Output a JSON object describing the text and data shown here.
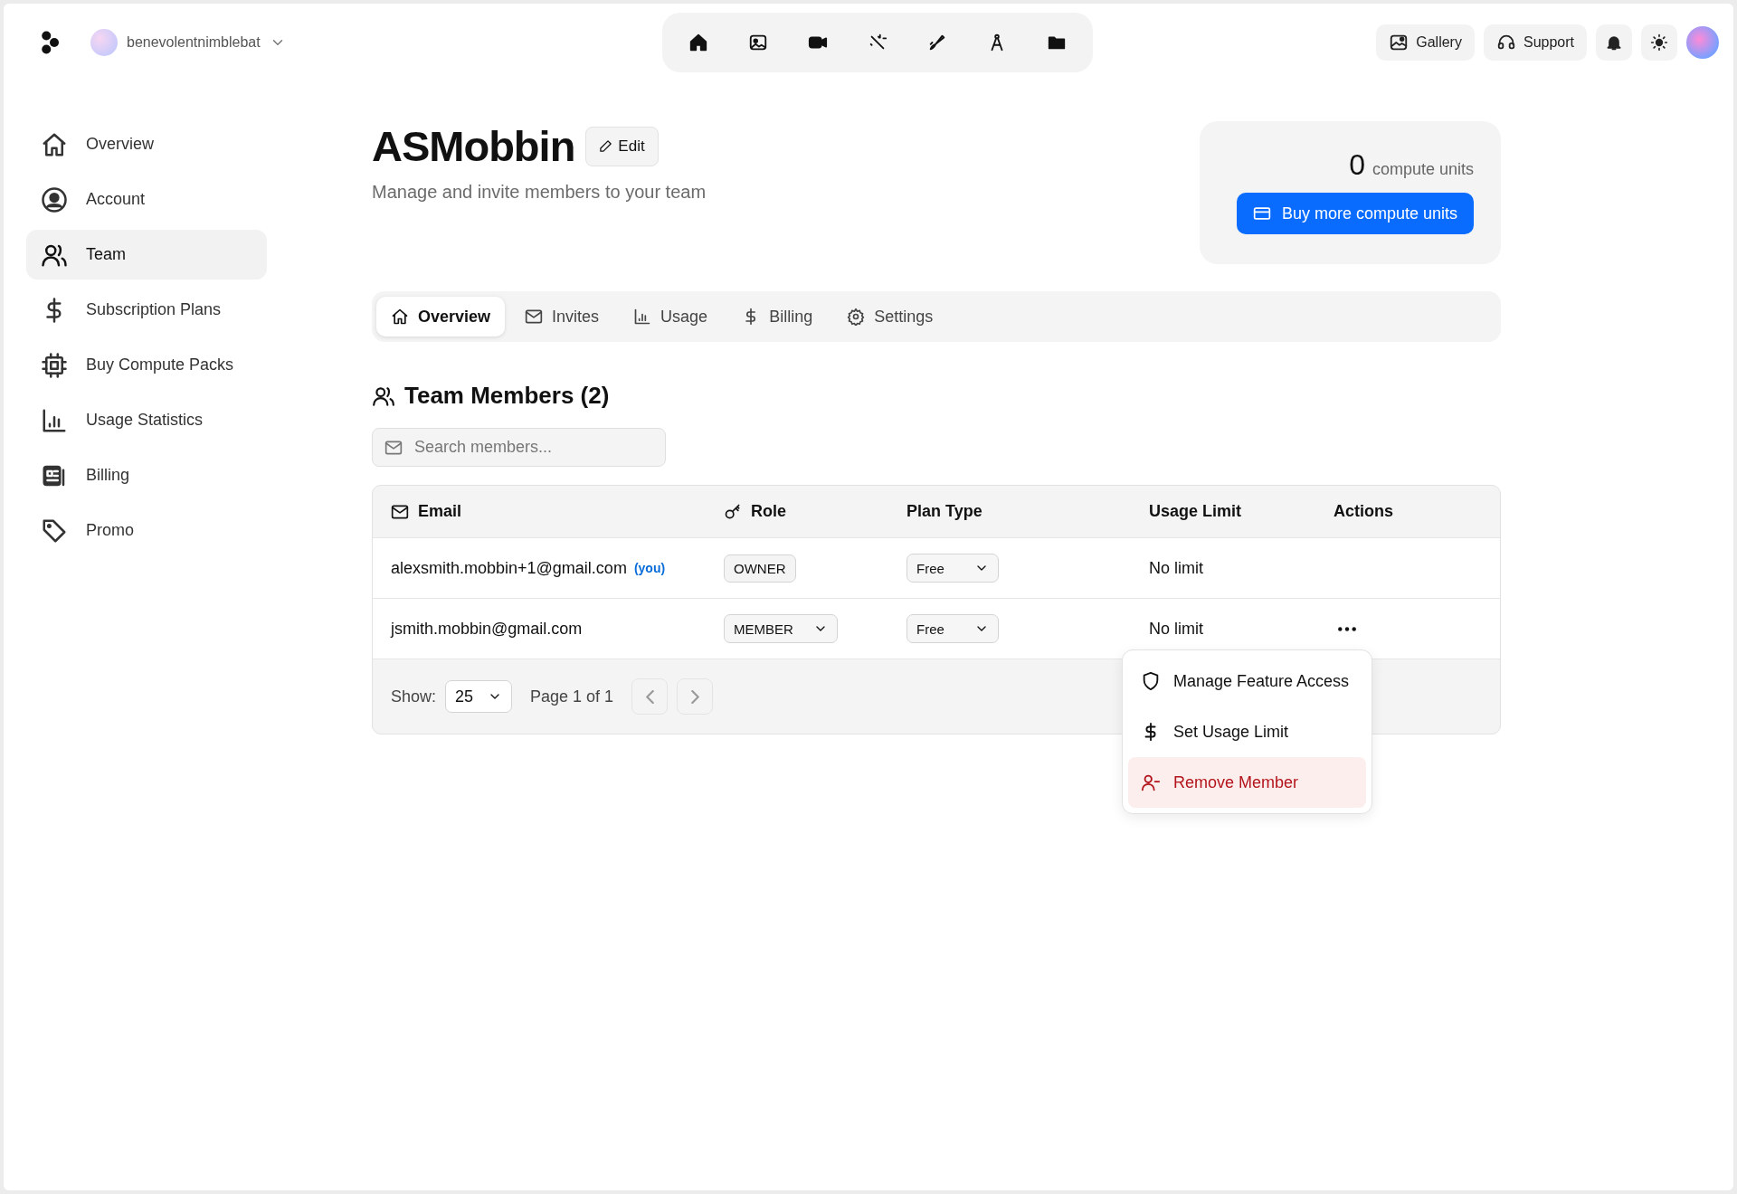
{
  "workspace": {
    "name": "benevolentnimblebat"
  },
  "topbar": {
    "buttons": [
      {
        "label": "Gallery"
      },
      {
        "label": "Support"
      }
    ]
  },
  "sidebar": {
    "items": [
      {
        "label": "Overview",
        "selected": false
      },
      {
        "label": "Account",
        "selected": false
      },
      {
        "label": "Team",
        "selected": true
      },
      {
        "label": "Subscription Plans",
        "selected": false
      },
      {
        "label": "Buy Compute Packs",
        "selected": false
      },
      {
        "label": "Usage Statistics",
        "selected": false
      },
      {
        "label": "Billing",
        "selected": false
      },
      {
        "label": "Promo",
        "selected": false
      }
    ]
  },
  "header": {
    "title": "ASMobbin",
    "edit_label": "Edit",
    "subtitle": "Manage and invite members to your team"
  },
  "compute": {
    "amount": "0",
    "unit": "compute units",
    "button": "Buy more compute units"
  },
  "tabs": [
    {
      "label": "Overview",
      "selected": true
    },
    {
      "label": "Invites",
      "selected": false
    },
    {
      "label": "Usage",
      "selected": false
    },
    {
      "label": "Billing",
      "selected": false
    },
    {
      "label": "Settings",
      "selected": false
    }
  ],
  "members": {
    "heading": "Team Members (2)",
    "search": {
      "placeholder": "Search members..."
    },
    "columns": [
      "Email",
      "Role",
      "Plan Type",
      "Usage Limit",
      "Actions"
    ],
    "rows": [
      {
        "email": "alexsmith.mobbin+1@gmail.com",
        "you_tag": "(you)",
        "role": {
          "kind": "badge",
          "label": "OWNER"
        },
        "plan": "Free",
        "usage_limit": "No limit",
        "actions": false
      },
      {
        "email": "jsmith.mobbin@gmail.com",
        "role": {
          "kind": "select",
          "label": "MEMBER"
        },
        "plan": "Free",
        "usage_limit": "No limit",
        "actions": true
      }
    ],
    "footer": {
      "show_label": "Show:",
      "page_size": "25",
      "page_info": "Page 1 of 1"
    }
  },
  "menu": {
    "items": [
      {
        "label": "Manage Feature Access",
        "kind": "normal",
        "selected": false
      },
      {
        "label": "Set Usage Limit",
        "kind": "normal",
        "selected": false
      },
      {
        "label": "Remove Member",
        "kind": "danger",
        "selected": true
      }
    ]
  }
}
